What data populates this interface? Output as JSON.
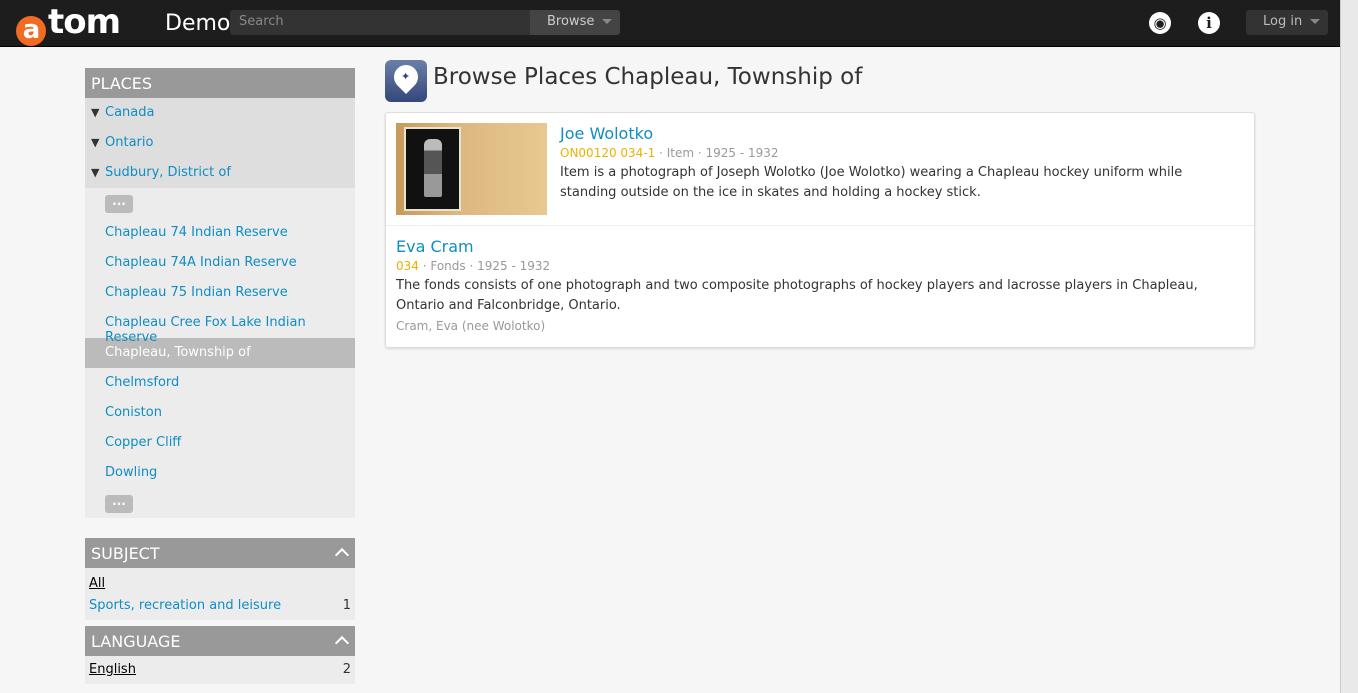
{
  "header": {
    "logo_letter": "a",
    "logo_rest": "tom",
    "site_name": "Demo",
    "search_placeholder": "Search",
    "browse_label": "Browse",
    "login_label": "Log in",
    "accent": "#f26b22"
  },
  "sidebar": {
    "places": {
      "title": "PLACES",
      "ancestors": [
        "Canada",
        "Ontario",
        "Sudbury, District of"
      ],
      "more_label": "...",
      "items": [
        {
          "label": "Chapleau 74 Indian Reserve"
        },
        {
          "label": "Chapleau 74A Indian Reserve"
        },
        {
          "label": "Chapleau 75 Indian Reserve"
        },
        {
          "label": "Chapleau Cree Fox Lake Indian Reserve"
        },
        {
          "label": "Chapleau, Township of",
          "active": true
        },
        {
          "label": "Chelmsford"
        },
        {
          "label": "Coniston"
        },
        {
          "label": "Copper Cliff"
        },
        {
          "label": "Dowling"
        }
      ]
    },
    "subject": {
      "title": "SUBJECT",
      "all_label": "All",
      "rows": [
        {
          "label": "Sports, recreation and leisure",
          "count": "1"
        }
      ]
    },
    "language": {
      "title": "LANGUAGE",
      "rows": [
        {
          "label": "English",
          "count": "2"
        }
      ]
    }
  },
  "main": {
    "title": "Browse Places Chapleau, Township of",
    "results": [
      {
        "title": "Joe Wolotko",
        "ref": "ON00120 034-1",
        "level": "Item",
        "dates": "1925 - 1932",
        "description": "Item is a photograph of Joseph Wolotko (Joe Wolotko) wearing a Chapleau hockey uniform while standing outside on the ice in skates and holding a hockey stick."
      },
      {
        "title": "Eva Cram",
        "ref": "034",
        "level": "Fonds",
        "dates": "1925 - 1932",
        "description": "The fonds consists of one photograph and two composite photographs of hockey players and lacrosse players in Chapleau, Ontario and Falconbridge, Ontario.",
        "creator": "Cram, Eva (nee Wolotko)"
      }
    ]
  }
}
